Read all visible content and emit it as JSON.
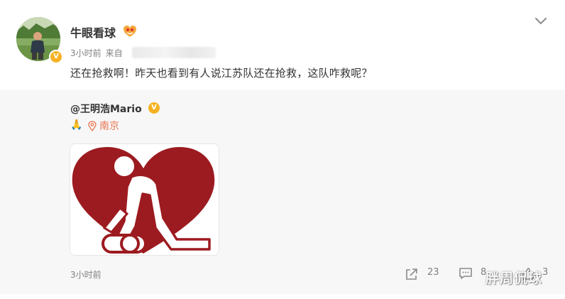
{
  "post": {
    "username": "牛眼看球",
    "time": "3小时前",
    "source_prefix": "来自",
    "content": "还在抢救啊！昨天也看到有人说江苏队还在抢救，这队咋救呢？",
    "verified_badge": "V"
  },
  "repost": {
    "original_user": "@王明浩Mario",
    "verified_badge": "V",
    "emoji": "🙏",
    "location": "南京",
    "time": "3小时前",
    "image_icon": "cpr-heart-icon"
  },
  "actions": {
    "share_count": "23",
    "comment_count": "8",
    "like_count": "3"
  },
  "watermark": "胖周侃球",
  "colors": {
    "heart": "#9c1b20",
    "accent": "#eb7350",
    "verified": "#f6b223"
  }
}
